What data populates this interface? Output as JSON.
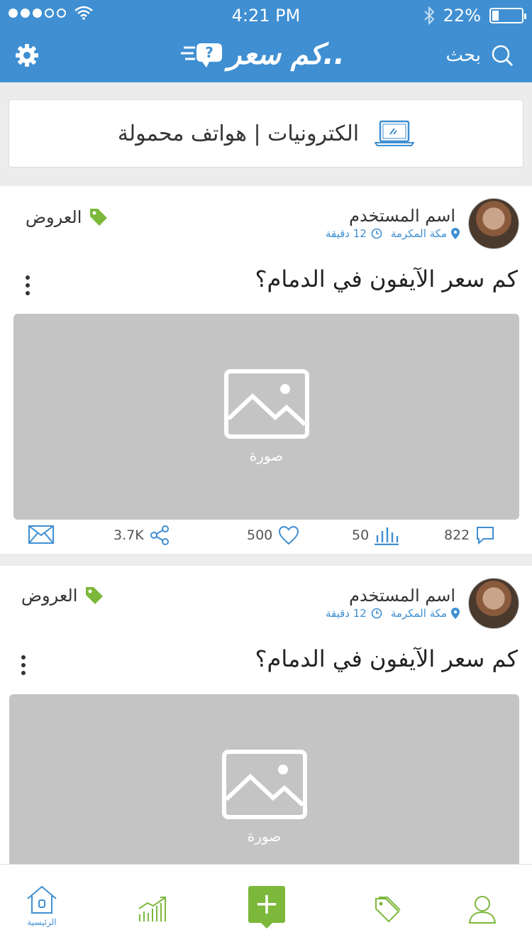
{
  "status_bar": {
    "time": "4:21 PM",
    "battery": "22%",
    "battery_level": 0.22
  },
  "app_bar": {
    "logo_text": "كم سعر..",
    "search_label": "بحث"
  },
  "category": {
    "text": "الكترونيات | هواتف محمولة"
  },
  "posts": [
    {
      "username": "اسم المستخدم",
      "location": "مكة المكرمة",
      "time": "12 دقيقة",
      "tag": "العروض",
      "title": "كم سعر الآيفون في الدمام؟",
      "image_label": "صورة",
      "comments": "822",
      "views": "50",
      "likes": "500",
      "shares": "3.7K"
    },
    {
      "username": "اسم المستخدم",
      "location": "مكة المكرمة",
      "time": "12 دقيقة",
      "tag": "العروض",
      "title": "كم سعر الآيفون في الدمام؟",
      "image_label": "صورة"
    }
  ],
  "tab_bar": {
    "home_label": "الرئيسية"
  },
  "colors": {
    "primary": "#3f8fd2",
    "accent": "#7cb83a",
    "placeholder": "#c4c4c4"
  }
}
